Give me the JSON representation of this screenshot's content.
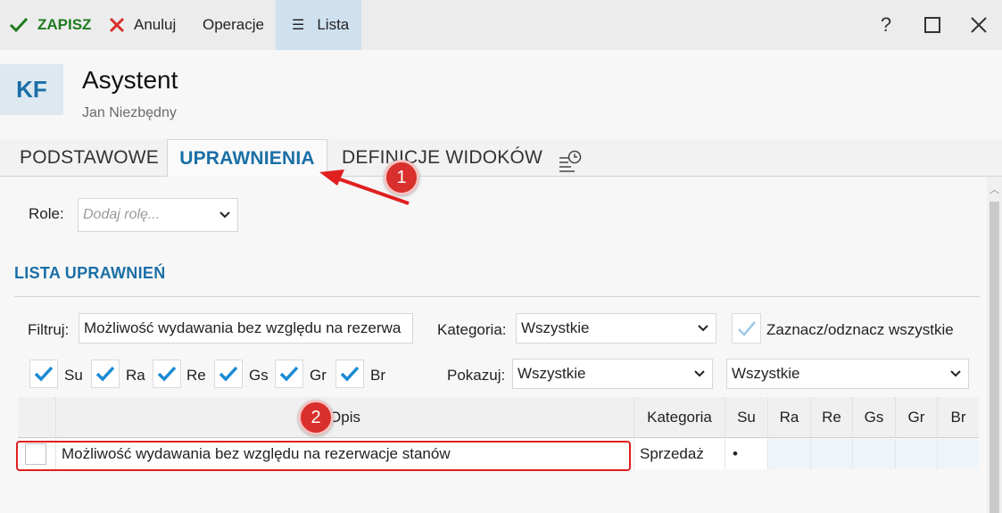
{
  "toolbar": {
    "save_label": "ZAPISZ",
    "cancel_label": "Anuluj",
    "operations_label": "Operacje",
    "list_label": "Lista",
    "help_label": "?"
  },
  "header": {
    "avatar_initials": "KF",
    "title": "Asystent",
    "subtitle": "Jan Niezbędny"
  },
  "tabs": [
    {
      "label": "PODSTAWOWE",
      "active": false
    },
    {
      "label": "UPRAWNIENIA",
      "active": true
    },
    {
      "label": "DEFINICJE WIDOKÓW",
      "active": false
    }
  ],
  "roles": {
    "label": "Role:",
    "placeholder": "Dodaj rolę..."
  },
  "section_title": "LISTA UPRAWNIEŃ",
  "filters": {
    "filter_label": "Filtruj:",
    "filter_value": "Możliwość wydawania bez względu na rezerwa",
    "category_label": "Kategoria:",
    "category_value": "Wszystkie",
    "toggle_all_label": "Zaznacz/odznacz wszystkie",
    "show_label": "Pokazuj:",
    "show_value": "Wszystkie",
    "show_value_2": "Wszystkie"
  },
  "flags": [
    {
      "label": "Su",
      "checked": true
    },
    {
      "label": "Ra",
      "checked": true
    },
    {
      "label": "Re",
      "checked": true
    },
    {
      "label": "Gs",
      "checked": true
    },
    {
      "label": "Gr",
      "checked": true
    },
    {
      "label": "Br",
      "checked": true
    }
  ],
  "table": {
    "columns": [
      "Opis",
      "Kategoria",
      "Su",
      "Ra",
      "Re",
      "Gs",
      "Gr",
      "Br"
    ],
    "rows": [
      {
        "opis": "Możliwość wydawania bez względu na rezerwacje stanów",
        "kategoria": "Sprzedaż",
        "su": "•",
        "ra": "",
        "re": "",
        "gs": "",
        "gr": "",
        "br": ""
      }
    ]
  },
  "annotations": [
    "1",
    "2"
  ],
  "colors": {
    "accent": "#1a6fa6",
    "save_green": "#1e7a1e",
    "cancel_red": "#d9302d",
    "annotation_red": "#d9302d"
  }
}
